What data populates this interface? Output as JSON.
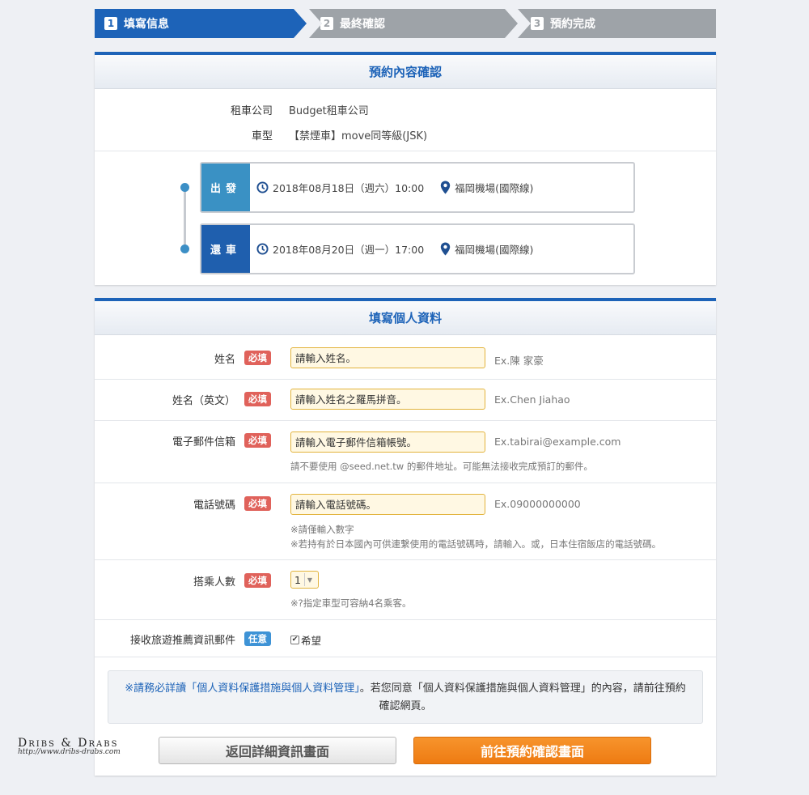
{
  "steps": [
    {
      "num": "1",
      "label": "填寫信息"
    },
    {
      "num": "2",
      "label": "最終確認"
    },
    {
      "num": "3",
      "label": "預約完成"
    }
  ],
  "booking": {
    "title": "預約內容確認",
    "company_label": "租車公司",
    "company_value": "Budget租車公司",
    "car_label": "車型",
    "car_value": "【禁煙車】move同等級(JSK)",
    "departure": {
      "tag": "出發",
      "datetime": "2018年08月18日（週六）10:00",
      "place": "福岡機場(國際線)"
    },
    "return": {
      "tag": "還車",
      "datetime": "2018年08月20日（週一）17:00",
      "place": "福岡機場(國際線)"
    }
  },
  "form": {
    "title": "填寫個人資料",
    "required_badge": "必填",
    "optional_badge": "任意",
    "name": {
      "label": "姓名",
      "placeholder": "請輸入姓名。",
      "example": "Ex.陳 家豪"
    },
    "name_en": {
      "label": "姓名（英文）",
      "placeholder": "請輸入姓名之羅馬拼音。",
      "example": "Ex.Chen Jiahao"
    },
    "email": {
      "label": "電子郵件信箱",
      "placeholder": "請輸入電子郵件信箱帳號。",
      "example": "Ex.tabirai@example.com",
      "note": "請不要使用 @seed.net.tw 的郵件地址。可能無法接收完成預訂的郵件。"
    },
    "phone": {
      "label": "電話號碼",
      "placeholder": "請輸入電話號碼。",
      "example": "Ex.09000000000",
      "note1": "※請僅輸入數字",
      "note2": "※若持有於日本國內可供連繫使用的電話號碼時，請輸入。或，日本住宿飯店的電話號碼。"
    },
    "passengers": {
      "label": "搭乘人數",
      "value": "1",
      "note": "※?指定車型可容納4名乘客。"
    },
    "newsletter": {
      "label": "接收旅遊推薦資訊郵件",
      "checkbox_label": "希望",
      "checked": true
    },
    "notice": {
      "prefix": "※請務必詳讀",
      "link": "「個人資料保護措施與個人資料管理」",
      "suffix": "。若您同意「個人資料保護措施與個人資料管理」的內容，請前往預約確認網頁。"
    },
    "back_button": "返回詳細資訊畫面",
    "next_button": "前往預約確認畫面"
  },
  "watermark": {
    "title": "Dribs & Drabs",
    "url": "http://www.dribs-drabs.com"
  },
  "colors": {
    "primary": "#1d63b8",
    "required": "#e0625b",
    "optional": "#3e93d6",
    "cta": "#f08418"
  }
}
